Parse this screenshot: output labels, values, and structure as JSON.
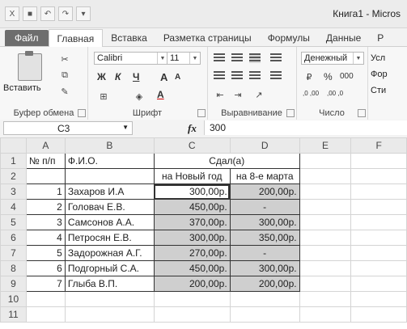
{
  "window": {
    "title": "Книга1 - Micros"
  },
  "tabs": [
    "Файл",
    "Главная",
    "Вставка",
    "Разметка страницы",
    "Формулы",
    "Данные",
    "Р"
  ],
  "ribbon": {
    "clipboard": {
      "paste": "Вставить",
      "label": "Буфер обмена"
    },
    "font": {
      "name": "Calibri",
      "size": "11",
      "label": "Шрифт",
      "bold": "Ж",
      "italic": "К",
      "underline": "Ч",
      "grow": "A",
      "shrink": "A",
      "color_a": "A"
    },
    "alignment": {
      "label": "Выравнивание"
    },
    "number": {
      "format": "Денежный",
      "label": "Число",
      "percent": "%",
      "thousands": "000",
      "inc": ",0 ,00",
      "dec": ",00 ,0"
    },
    "styles": {
      "items": [
        "Усл",
        "Фор",
        "Сти"
      ]
    }
  },
  "formula_bar": {
    "cell": "C3",
    "fx": "fx",
    "value": "300"
  },
  "grid": {
    "columns": [
      "A",
      "B",
      "C",
      "D",
      "E",
      "F"
    ],
    "rows": [
      {
        "n": "1",
        "a": "№ п/п",
        "b": "Ф.И.О.",
        "c": "Сдал(а)",
        "d": ""
      },
      {
        "n": "2",
        "a": "",
        "b": "",
        "c": "на Новый год",
        "d": "на 8-е марта"
      },
      {
        "n": "3",
        "a": "1",
        "b": "Захаров И.А",
        "c": "300,00р.",
        "d": "200,00р."
      },
      {
        "n": "4",
        "a": "2",
        "b": "Головач Е.В.",
        "c": "450,00р.",
        "d": "-"
      },
      {
        "n": "5",
        "a": "3",
        "b": "Самсонов А.А.",
        "c": "370,00р.",
        "d": "300,00р."
      },
      {
        "n": "6",
        "a": "4",
        "b": "Петросян Е.В.",
        "c": "300,00р.",
        "d": "350,00р."
      },
      {
        "n": "7",
        "a": "5",
        "b": "Задорожная А.Г.",
        "c": "270,00р.",
        "d": "-"
      },
      {
        "n": "8",
        "a": "6",
        "b": "Подгорный С.А.",
        "c": "450,00р.",
        "d": "300,00р."
      },
      {
        "n": "9",
        "a": "7",
        "b": "Глыба В.П.",
        "c": "200,00р.",
        "d": "200,00р."
      },
      {
        "n": "10",
        "a": "",
        "b": "",
        "c": "",
        "d": ""
      },
      {
        "n": "11",
        "a": "",
        "b": "",
        "c": "",
        "d": ""
      }
    ]
  }
}
